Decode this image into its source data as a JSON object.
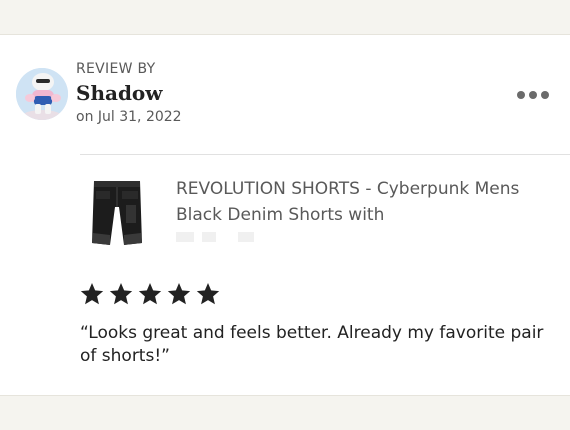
{
  "review": {
    "label": "REVIEW BY",
    "reviewer_name": "Shadow",
    "date": "on Jul 31, 2022",
    "rating": 5,
    "rating_max": 5,
    "text": "“Looks great and feels better. Already my favorite pair of shorts!”"
  },
  "product": {
    "title": "REVOLUTION SHORTS - Cyberpunk Mens Black Denim Shorts with",
    "image_icon": "black-denim-shorts-thumbnail"
  },
  "menu": {
    "icon": "more-options-icon"
  },
  "colors": {
    "page_background": "#f5f4ef",
    "card_background": "#ffffff",
    "star": "#222222",
    "muted_text": "#595959"
  }
}
